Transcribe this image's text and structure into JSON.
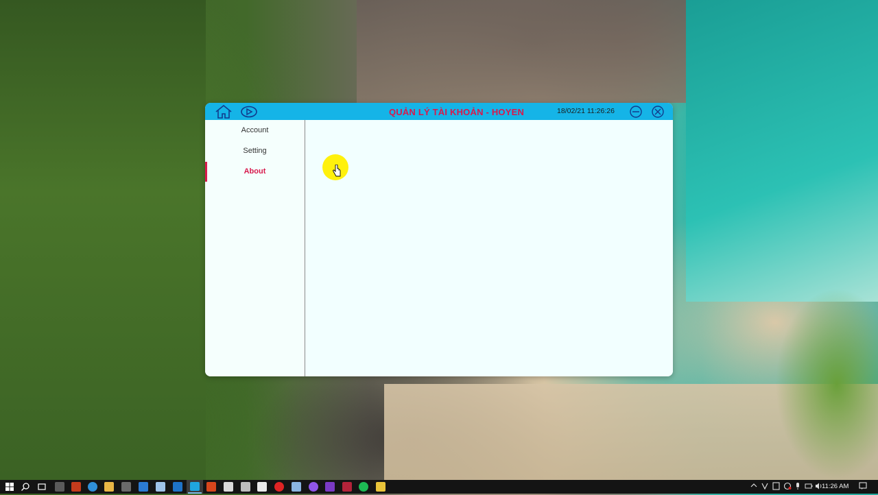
{
  "window": {
    "title": "QUẢN LÝ TÀI KHOẢN - HOYEN",
    "datetime": "18/02/21 11:26:26",
    "toolbar_icons": [
      "home-icon",
      "play-icon"
    ],
    "controls": [
      "minimize-icon",
      "close-icon"
    ],
    "accent_color": "#15b4e7",
    "highlight_color": "#d8194c"
  },
  "sidebar": {
    "items": [
      {
        "label": "Account",
        "active": false
      },
      {
        "label": "Setting",
        "active": false
      },
      {
        "label": "About",
        "active": true
      }
    ]
  },
  "taskbar": {
    "icons": [
      "windows-start-icon",
      "search-icon",
      "task-view-icon",
      "widget-icon",
      "app-icon",
      "edge-icon",
      "file-explorer-icon",
      "store-icon",
      "mail-icon",
      "app-icon",
      "vscode-icon",
      "active-app-icon",
      "office-icon",
      "app-icon",
      "lock-icon",
      "app-icon",
      "app-icon",
      "record-icon",
      "app-icon",
      "messenger-icon",
      "visual-studio-icon",
      "app-icon",
      "spotify-icon",
      "app-icon"
    ],
    "tray_icons": [
      "chevron-up-icon",
      "network-icon",
      "app-icon",
      "app-icon",
      "microphone-icon",
      "battery-icon",
      "volume-icon",
      "keyboard-icon"
    ],
    "time": "11:26 AM"
  }
}
